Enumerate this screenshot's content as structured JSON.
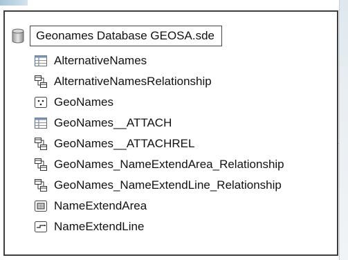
{
  "catalog": {
    "root": {
      "label": "Geonames Database GEOSA.sde",
      "icon": "database-icon"
    },
    "items": [
      {
        "label": "AlternativeNames",
        "icon": "table-icon"
      },
      {
        "label": "AlternativeNamesRelationship",
        "icon": "relationship-class-icon"
      },
      {
        "label": "GeoNames",
        "icon": "point-feature-class-icon"
      },
      {
        "label": "GeoNames__ATTACH",
        "icon": "table-icon"
      },
      {
        "label": "GeoNames__ATTACHREL",
        "icon": "relationship-class-icon"
      },
      {
        "label": "GeoNames_NameExtendArea_Relationship",
        "icon": "relationship-class-icon"
      },
      {
        "label": "GeoNames_NameExtendLine_Relationship",
        "icon": "relationship-class-icon"
      },
      {
        "label": "NameExtendArea",
        "icon": "polygon-feature-class-icon"
      },
      {
        "label": "NameExtendLine",
        "icon": "line-feature-class-icon"
      }
    ]
  }
}
